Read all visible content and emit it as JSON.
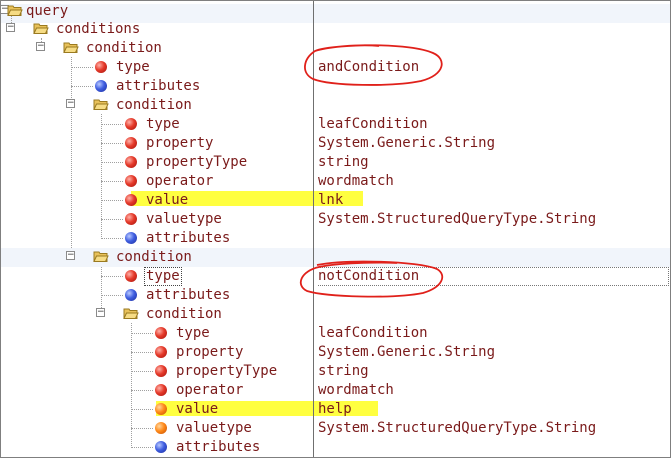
{
  "tree": {
    "rows": [
      {
        "label": "query",
        "value": ""
      },
      {
        "label": "conditions",
        "value": ""
      },
      {
        "label": "condition",
        "value": ""
      },
      {
        "label": "type",
        "value": "andCondition"
      },
      {
        "label": "attributes",
        "value": ""
      },
      {
        "label": "condition",
        "value": ""
      },
      {
        "label": "type",
        "value": "leafCondition"
      },
      {
        "label": "property",
        "value": "System.Generic.String"
      },
      {
        "label": "propertyType",
        "value": "string"
      },
      {
        "label": "operator",
        "value": "wordmatch"
      },
      {
        "label": "value",
        "value": "lnk"
      },
      {
        "label": "valuetype",
        "value": "System.StructuredQueryType.String"
      },
      {
        "label": "attributes",
        "value": ""
      },
      {
        "label": "condition",
        "value": ""
      },
      {
        "label": "type",
        "value": "notCondition"
      },
      {
        "label": "attributes",
        "value": ""
      },
      {
        "label": "condition",
        "value": ""
      },
      {
        "label": "type",
        "value": "leafCondition"
      },
      {
        "label": "property",
        "value": "System.Generic.String"
      },
      {
        "label": "propertyType",
        "value": "string"
      },
      {
        "label": "operator",
        "value": "wordmatch"
      },
      {
        "label": "value",
        "value": "help"
      },
      {
        "label": "valuetype",
        "value": "System.StructuredQueryType.String"
      },
      {
        "label": "attributes",
        "value": ""
      }
    ]
  },
  "icons": {
    "folder": "folder-icon",
    "element": "red-ball-icon",
    "attribute": "blue-ball-icon",
    "highlighted_element": "orange-ball-icon"
  },
  "colors": {
    "text": "#7a1a1a",
    "highlight": "#ffff40",
    "annotation": "#e0201a",
    "alt_row": "#f1f5fb"
  }
}
